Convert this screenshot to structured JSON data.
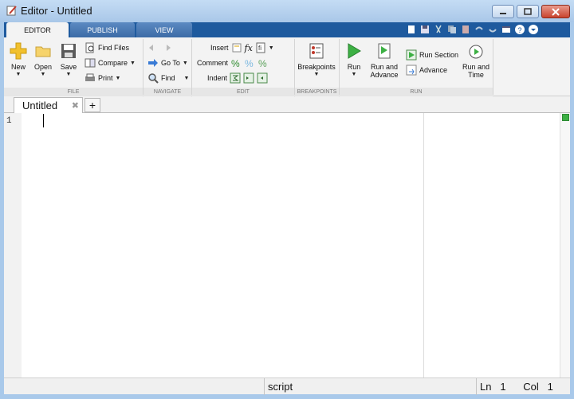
{
  "window": {
    "title": "Editor - Untitled"
  },
  "ribbon_tabs": [
    {
      "label": "EDITOR",
      "active": true
    },
    {
      "label": "PUBLISH",
      "active": false
    },
    {
      "label": "VIEW",
      "active": false
    }
  ],
  "quick_access_icons": [
    "new-icon",
    "save-icon",
    "cut-icon",
    "copy-icon",
    "paste-icon",
    "undo-icon",
    "redo-icon",
    "window-icon",
    "help-icon",
    "options-icon"
  ],
  "groups": {
    "file": {
      "label": "FILE",
      "new": "New",
      "open": "Open",
      "save": "Save",
      "find_files": "Find Files",
      "compare": "Compare",
      "print": "Print"
    },
    "navigate": {
      "label": "NAVIGATE",
      "go_to": "Go To",
      "find": "Find"
    },
    "edit": {
      "label": "EDIT",
      "insert": "Insert",
      "comment": "Comment",
      "indent": "Indent",
      "fx": "fx"
    },
    "breakpoints": {
      "label": "BREAKPOINTS",
      "breakpoints": "Breakpoints"
    },
    "run": {
      "label": "RUN",
      "run": "Run",
      "run_and_advance_1": "Run and",
      "run_and_advance_2": "Advance",
      "run_section": "Run Section",
      "advance": "Advance",
      "run_and_time_1": "Run and",
      "run_and_time_2": "Time"
    }
  },
  "doc_tabs": [
    {
      "label": "Untitled"
    }
  ],
  "editor": {
    "line_numbers": [
      "1"
    ]
  },
  "status": {
    "mode": "script",
    "ln_label": "Ln",
    "ln": "1",
    "col_label": "Col",
    "col": "1"
  },
  "colors": {
    "tabstrip": "#1e5a9e",
    "run_green": "#3cb043",
    "code_ok": "#3cb043"
  }
}
